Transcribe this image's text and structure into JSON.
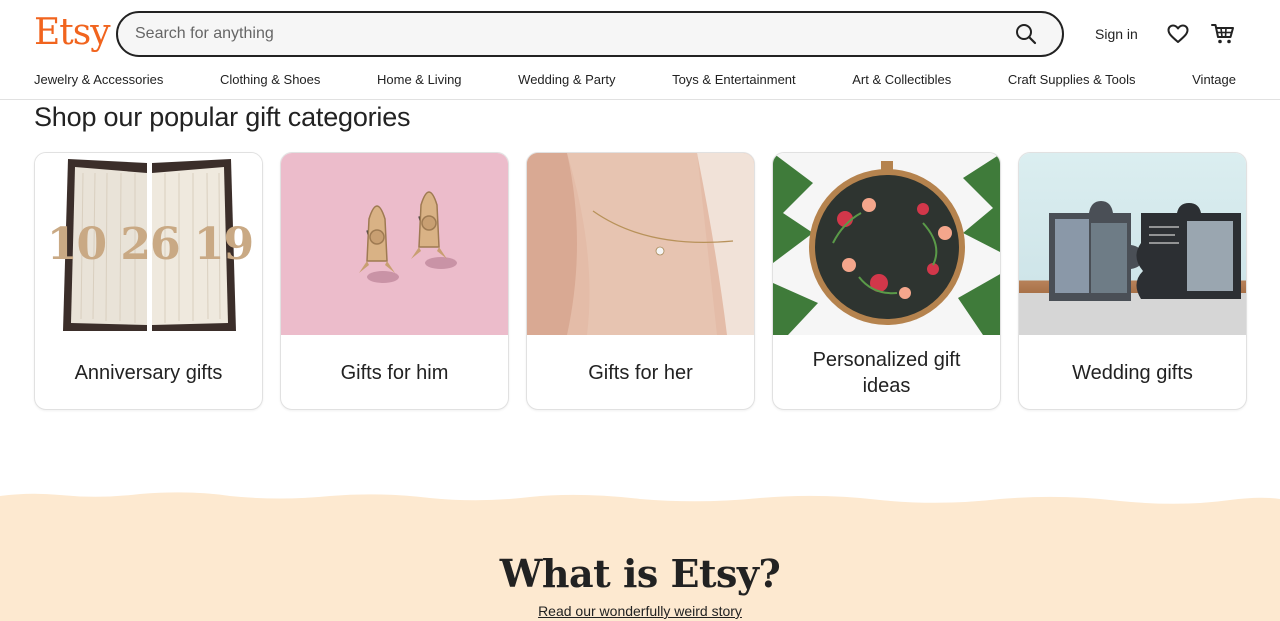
{
  "header": {
    "logo": "Etsy",
    "search_placeholder": "Search for anything",
    "sign_in": "Sign in"
  },
  "nav": [
    "Jewelry & Accessories",
    "Clothing & Shoes",
    "Home & Living",
    "Wedding & Party",
    "Toys & Entertainment",
    "Art & Collectibles",
    "Craft Supplies & Tools",
    "Vintage"
  ],
  "gift_section": {
    "title": "Shop our popular gift categories",
    "cards": [
      {
        "label": "Anniversary gifts",
        "image_text": "10 26 19"
      },
      {
        "label": "Gifts for him"
      },
      {
        "label": "Gifts for her"
      },
      {
        "label": "Personalized gift ideas"
      },
      {
        "label": "Wedding gifts"
      }
    ]
  },
  "about": {
    "heading": "What is Etsy?",
    "link": "Read our wonderfully weird story"
  },
  "colors": {
    "brand": "#f1641e",
    "footer_band": "#fde9d0",
    "text": "#222222"
  }
}
